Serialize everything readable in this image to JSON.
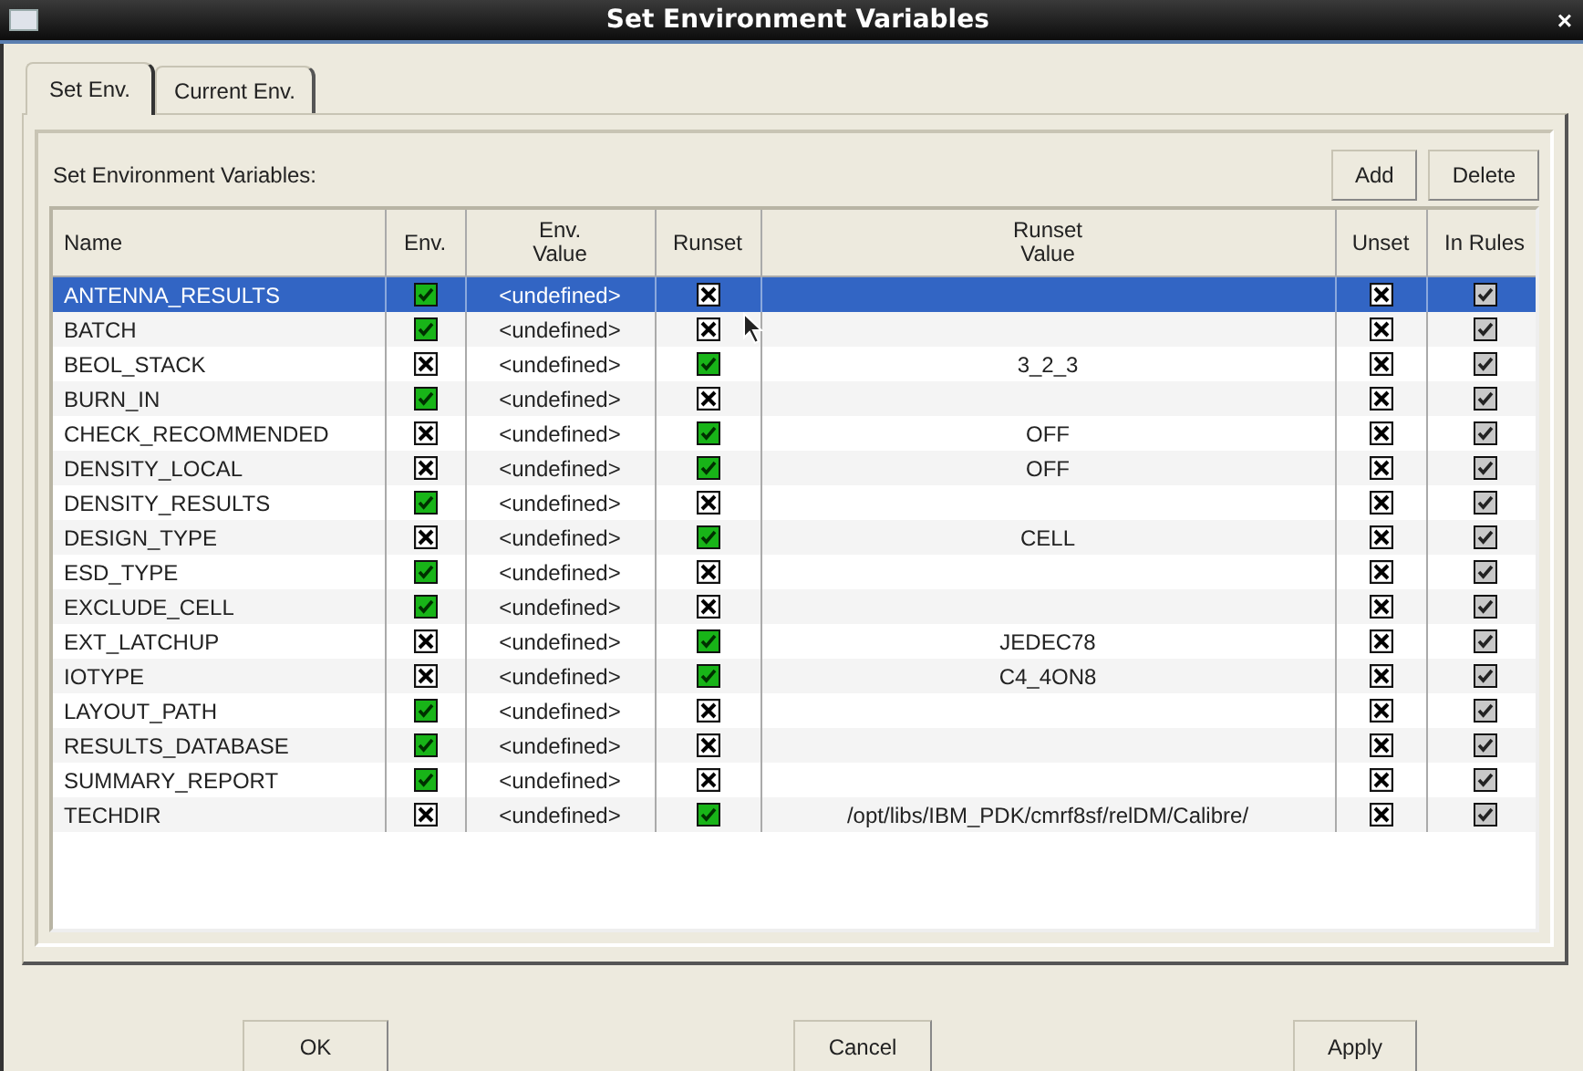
{
  "window": {
    "title": "Set Environment Variables",
    "close": "×"
  },
  "tabs": [
    {
      "label": "Set Env.",
      "selected": true
    },
    {
      "label": "Current Env.",
      "selected": false
    }
  ],
  "panel": {
    "label": "Set Environment Variables:",
    "buttons": [
      "Add",
      "Delete"
    ]
  },
  "table": {
    "columns": [
      "Name",
      "Env.",
      "Env.\nValue",
      "Runset",
      "Runset\nValue",
      "Unset",
      "In Rules"
    ],
    "rows": [
      {
        "name": "ANTENNA_RESULTS",
        "env": true,
        "env_value": "<undefined>",
        "runset": false,
        "runset_value": "",
        "unset": false,
        "in_rules": true,
        "selected": true
      },
      {
        "name": "BATCH",
        "env": true,
        "env_value": "<undefined>",
        "runset": false,
        "runset_value": "",
        "unset": false,
        "in_rules": true,
        "selected": false
      },
      {
        "name": "BEOL_STACK",
        "env": false,
        "env_value": "<undefined>",
        "runset": true,
        "runset_value": "3_2_3",
        "unset": false,
        "in_rules": true,
        "selected": false
      },
      {
        "name": "BURN_IN",
        "env": true,
        "env_value": "<undefined>",
        "runset": false,
        "runset_value": "",
        "unset": false,
        "in_rules": true,
        "selected": false
      },
      {
        "name": "CHECK_RECOMMENDED",
        "env": false,
        "env_value": "<undefined>",
        "runset": true,
        "runset_value": "OFF",
        "unset": false,
        "in_rules": true,
        "selected": false
      },
      {
        "name": "DENSITY_LOCAL",
        "env": false,
        "env_value": "<undefined>",
        "runset": true,
        "runset_value": "OFF",
        "unset": false,
        "in_rules": true,
        "selected": false
      },
      {
        "name": "DENSITY_RESULTS",
        "env": true,
        "env_value": "<undefined>",
        "runset": false,
        "runset_value": "",
        "unset": false,
        "in_rules": true,
        "selected": false
      },
      {
        "name": "DESIGN_TYPE",
        "env": false,
        "env_value": "<undefined>",
        "runset": true,
        "runset_value": "CELL",
        "unset": false,
        "in_rules": true,
        "selected": false
      },
      {
        "name": "ESD_TYPE",
        "env": true,
        "env_value": "<undefined>",
        "runset": false,
        "runset_value": "",
        "unset": false,
        "in_rules": true,
        "selected": false
      },
      {
        "name": "EXCLUDE_CELL",
        "env": true,
        "env_value": "<undefined>",
        "runset": false,
        "runset_value": "",
        "unset": false,
        "in_rules": true,
        "selected": false
      },
      {
        "name": "EXT_LATCHUP",
        "env": false,
        "env_value": "<undefined>",
        "runset": true,
        "runset_value": "JEDEC78",
        "unset": false,
        "in_rules": true,
        "selected": false
      },
      {
        "name": "IOTYPE",
        "env": false,
        "env_value": "<undefined>",
        "runset": true,
        "runset_value": "C4_4ON8",
        "unset": false,
        "in_rules": true,
        "selected": false
      },
      {
        "name": "LAYOUT_PATH",
        "env": true,
        "env_value": "<undefined>",
        "runset": false,
        "runset_value": "",
        "unset": false,
        "in_rules": true,
        "selected": false
      },
      {
        "name": "RESULTS_DATABASE",
        "env": true,
        "env_value": "<undefined>",
        "runset": false,
        "runset_value": "",
        "unset": false,
        "in_rules": true,
        "selected": false
      },
      {
        "name": "SUMMARY_REPORT",
        "env": true,
        "env_value": "<undefined>",
        "runset": false,
        "runset_value": "",
        "unset": false,
        "in_rules": true,
        "selected": false
      },
      {
        "name": "TECHDIR",
        "env": false,
        "env_value": "<undefined>",
        "runset": true,
        "runset_value": "/opt/libs/IBM_PDK/cmrf8sf/relDM/Calibre/",
        "unset": false,
        "in_rules": true,
        "selected": false
      }
    ]
  },
  "footer": {
    "buttons": [
      "OK",
      "Cancel",
      "Apply"
    ]
  }
}
